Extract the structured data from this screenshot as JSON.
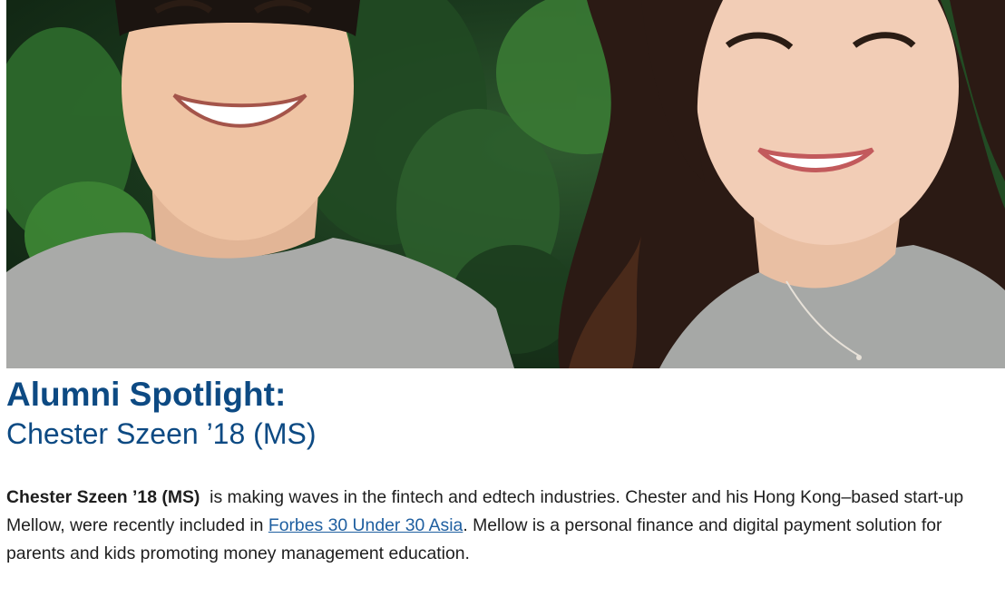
{
  "hero": {
    "alt": "Two people in grey t-shirts smiling in front of a green leafy wall"
  },
  "heading": {
    "main": "Alumni Spotlight:",
    "sub": "Chester Szeen ’18 (MS)"
  },
  "article": {
    "name_bold": "Chester Szeen ’18 (MS)",
    "text_before_link": "  is making waves in the fintech and edtech industries. Chester and his Hong Kong–based start-up Mellow, were recently included in ",
    "link_label": "Forbes 30 Under 30 Asia",
    "text_after_link": ". Mellow is a personal finance and digital payment solution for parents and kids promoting money management education."
  },
  "colors": {
    "heading": "#0d4a83",
    "link": "#1f5fa0",
    "body_text": "#1e1e1e"
  }
}
